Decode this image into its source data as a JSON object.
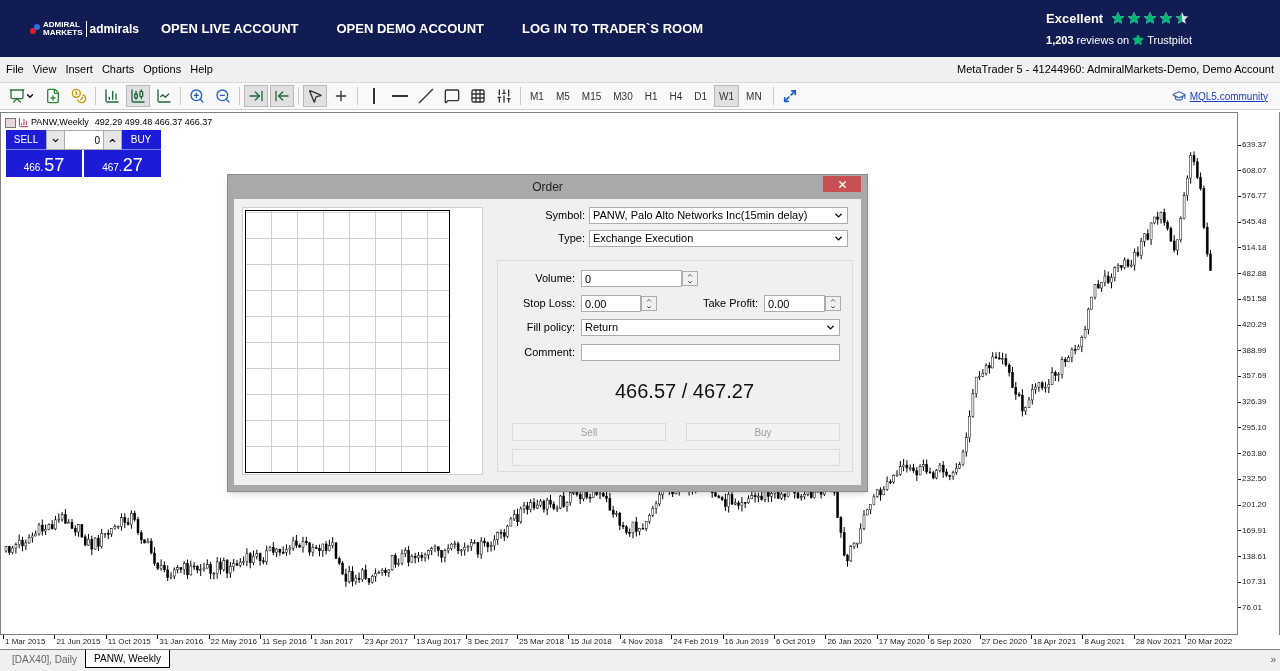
{
  "header": {
    "logo_lines": [
      "ADMIRAL",
      "MARKETS"
    ],
    "logo_brand": "admirals",
    "nav": [
      "OPEN LIVE ACCOUNT",
      "OPEN DEMO ACCOUNT",
      "LOG IN TO TRADER`S ROOM"
    ],
    "rating_label": "Excellent",
    "stars": 4.5,
    "reviews_count": "1,203",
    "reviews_suffix": "reviews on",
    "trustpilot": "Trustpilot"
  },
  "menu": [
    "File",
    "View",
    "Insert",
    "Charts",
    "Options",
    "Help"
  ],
  "account_title": "MetaTrader 5 - 41244960: AdmiralMarkets-Demo, Demo Account",
  "toolbar": {
    "tools": [
      {
        "pressed": false
      },
      {
        "pressed": false
      },
      {
        "pressed": false
      },
      {
        "pressed": false
      },
      {
        "pressed": true
      },
      {
        "pressed": false
      },
      {
        "pressed": false
      },
      {
        "pressed": false
      },
      {
        "pressed": true
      },
      {
        "pressed": true
      },
      {
        "pressed": true
      },
      {
        "pressed": false
      },
      {
        "pressed": false
      },
      {
        "pressed": false
      },
      {
        "pressed": false
      },
      {
        "pressed": false
      },
      {
        "pressed": false
      },
      {
        "pressed": false
      }
    ],
    "timeframes": [
      {
        "label": "M1",
        "selected": false
      },
      {
        "label": "M5",
        "selected": false
      },
      {
        "label": "M15",
        "selected": false
      },
      {
        "label": "M30",
        "selected": false
      },
      {
        "label": "H1",
        "selected": false
      },
      {
        "label": "H4",
        "selected": false
      },
      {
        "label": "D1",
        "selected": false
      },
      {
        "label": "W1",
        "selected": true
      },
      {
        "label": "MN",
        "selected": false
      }
    ],
    "community_link": "MQL5.community"
  },
  "chart": {
    "title": "PANW,Weekly",
    "ohlc": "492.29 499.48 466.37 466.37",
    "price_axis": [
      "639.37",
      "608.07",
      "576.77",
      "545.48",
      "514.18",
      "482.88",
      "451.58",
      "420.29",
      "388.99",
      "357.69",
      "326.39",
      "295.10",
      "263.80",
      "232.50",
      "201.20",
      "169.91",
      "138.61",
      "107.31",
      "76.01"
    ],
    "time_axis": [
      "1 Mar 2015",
      "21 Jun 2015",
      "11 Oct 2015",
      "31 Jan 2016",
      "22 May 2016",
      "11 Sep 2016",
      "1 Jan 2017",
      "23 Apr 2017",
      "13 Aug 2017",
      "3 Dec 2017",
      "25 Mar 2018",
      "15 Jul 2018",
      "4 Nov 2018",
      "24 Feb 2019",
      "16 Jun 2019",
      "6 Oct 2019",
      "26 Jan 2020",
      "17 May 2020",
      "6 Sep 2020",
      "27 Dec 2020",
      "18 Apr 2021",
      "8 Aug 2021",
      "28 Nov 2021",
      "20 Mar 2022"
    ]
  },
  "trade_panel": {
    "sell": "SELL",
    "buy": "BUY",
    "volume": "0",
    "bid_int": "466.",
    "bid_frac": "57",
    "ask_int": "467.",
    "ask_frac": "27"
  },
  "order_dialog": {
    "title": "Order",
    "symbol_label": "Symbol:",
    "symbol": "PANW, Palo Alto Networks Inc(15min delay)",
    "type_label": "Type:",
    "type": "Exchange Execution",
    "volume_label": "Volume:",
    "volume": "0",
    "stop_loss_label": "Stop Loss:",
    "stop_loss": "0.00",
    "take_profit_label": "Take Profit:",
    "take_profit": "0.00",
    "fill_policy_label": "Fill policy:",
    "fill_policy": "Return",
    "comment_label": "Comment:",
    "quote": "466.57 / 467.27",
    "sell": {
      "label": "Sell",
      "disabled": true
    },
    "buy": {
      "label": "Buy",
      "disabled": true
    }
  },
  "tabs": [
    {
      "label": "[DAX40], Daily",
      "selected": false
    },
    {
      "label": "PANW, Weekly",
      "selected": true
    }
  ],
  "tabs_more": "»"
}
